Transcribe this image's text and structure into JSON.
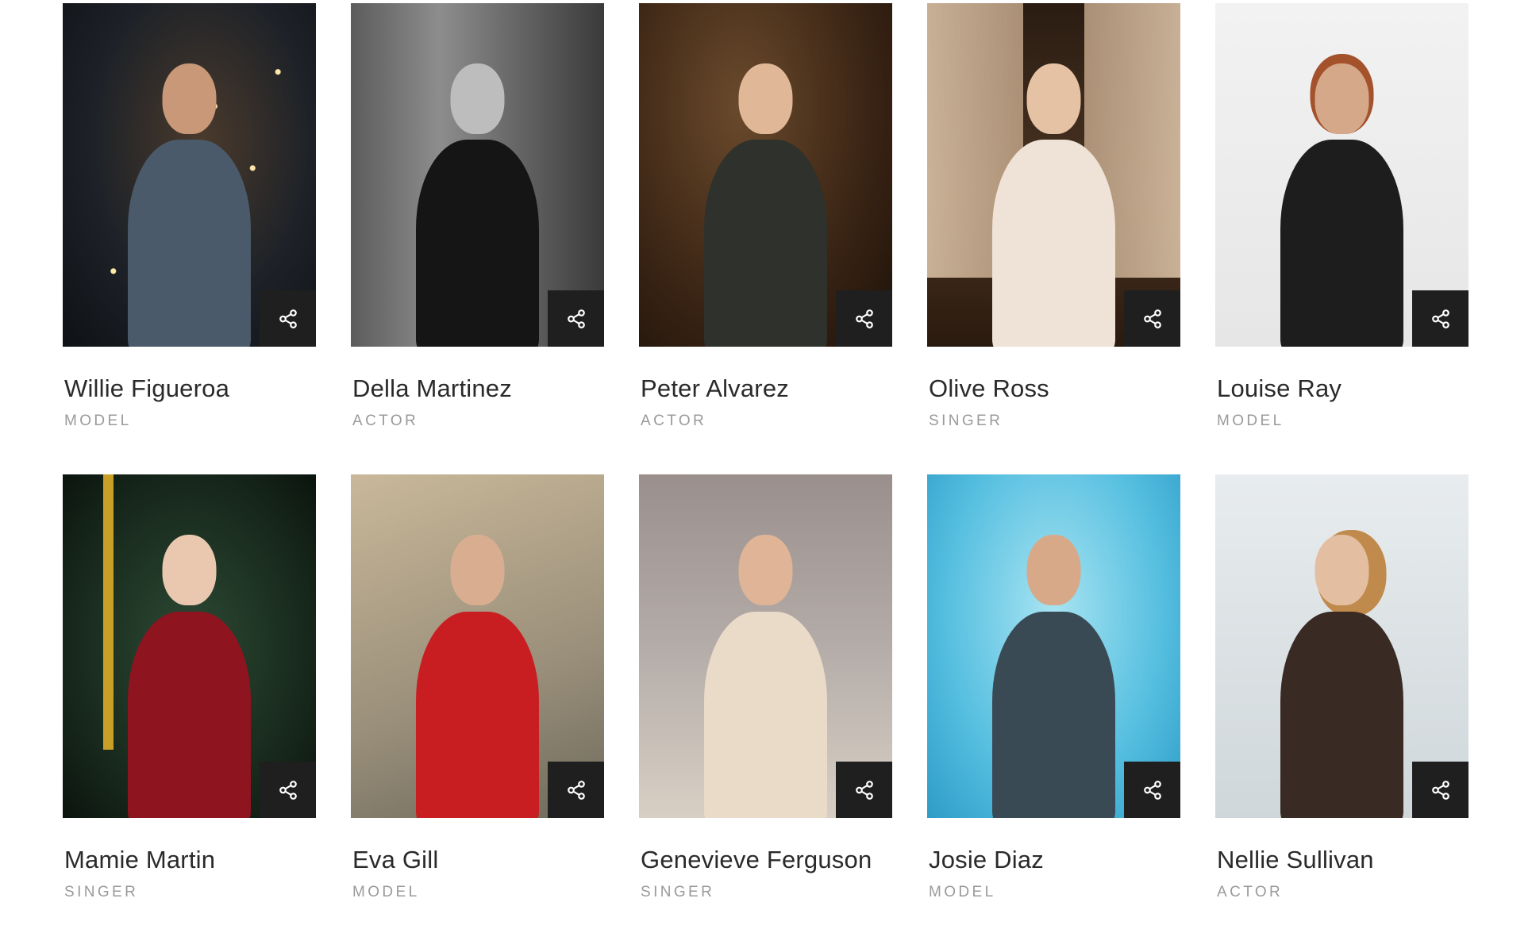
{
  "cards": [
    {
      "name": "Willie Figueroa",
      "role": "MODEL",
      "photo": "portrait-man-fairy-lights"
    },
    {
      "name": "Della Martinez",
      "role": "ACTOR",
      "photo": "portrait-woman-black-bodysuit-bw"
    },
    {
      "name": "Peter Alvarez",
      "role": "ACTOR",
      "photo": "portrait-woman-victorian-umbrella"
    },
    {
      "name": "Olive Ross",
      "role": "SINGER",
      "photo": "portrait-bride-curtains-bulbs"
    },
    {
      "name": "Louise Ray",
      "role": "MODEL",
      "photo": "portrait-redhead-black-top"
    },
    {
      "name": "Mamie Martin",
      "role": "SINGER",
      "photo": "portrait-woman-red-gown-garden"
    },
    {
      "name": "Eva Gill",
      "role": "MODEL",
      "photo": "portrait-woman-red-jacket-glasses"
    },
    {
      "name": "Genevieve Ferguson",
      "role": "SINGER",
      "photo": "portrait-woman-brick-wall-chair"
    },
    {
      "name": "Josie Diaz",
      "role": "MODEL",
      "photo": "portrait-woman-pool-background"
    },
    {
      "name": "Nellie Sullivan",
      "role": "ACTOR",
      "photo": "portrait-woman-mesh-bodysuit"
    }
  ],
  "share_icon": "share-icon",
  "colors": {
    "name_text": "#2a2a2a",
    "role_text": "#9a9a9a",
    "share_button_bg": "#1f1f1f",
    "share_icon": "#ffffff"
  }
}
